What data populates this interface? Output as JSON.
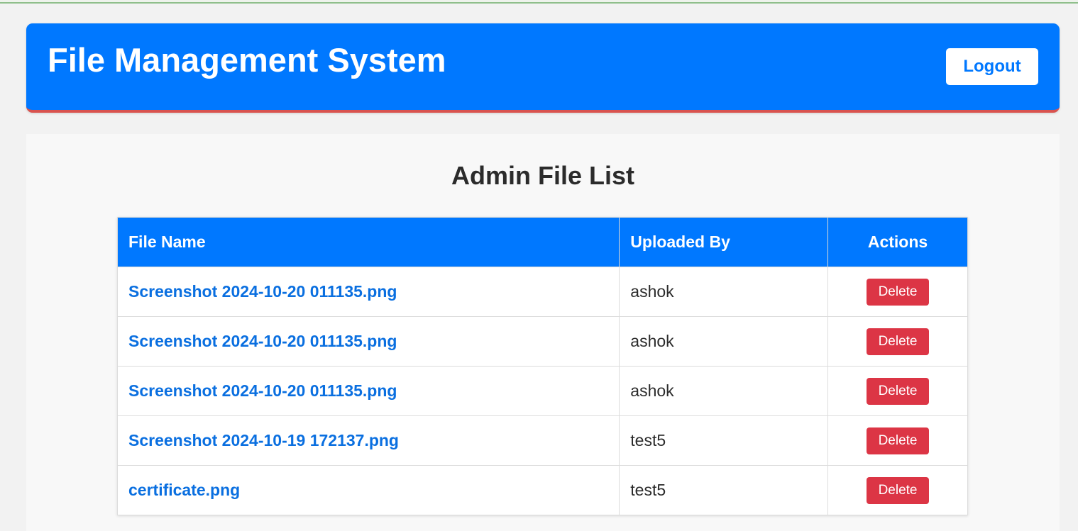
{
  "header": {
    "title": "File Management System",
    "logout_label": "Logout"
  },
  "panel": {
    "title": "Admin File List"
  },
  "table": {
    "columns": [
      "File Name",
      "Uploaded By",
      "Actions"
    ],
    "rows": [
      {
        "file_name": "Screenshot 2024-10-20 011135.png",
        "uploaded_by": "ashok",
        "action_label": "Delete"
      },
      {
        "file_name": "Screenshot 2024-10-20 011135.png",
        "uploaded_by": "ashok",
        "action_label": "Delete"
      },
      {
        "file_name": "Screenshot 2024-10-20 011135.png",
        "uploaded_by": "ashok",
        "action_label": "Delete"
      },
      {
        "file_name": "Screenshot 2024-10-19 172137.png",
        "uploaded_by": "test5",
        "action_label": "Delete"
      },
      {
        "file_name": "certificate.png",
        "uploaded_by": "test5",
        "action_label": "Delete"
      }
    ]
  },
  "colors": {
    "primary": "#0078ff",
    "danger": "#dc3545",
    "link": "#0a6fe0",
    "header_accent": "#d9534f"
  }
}
